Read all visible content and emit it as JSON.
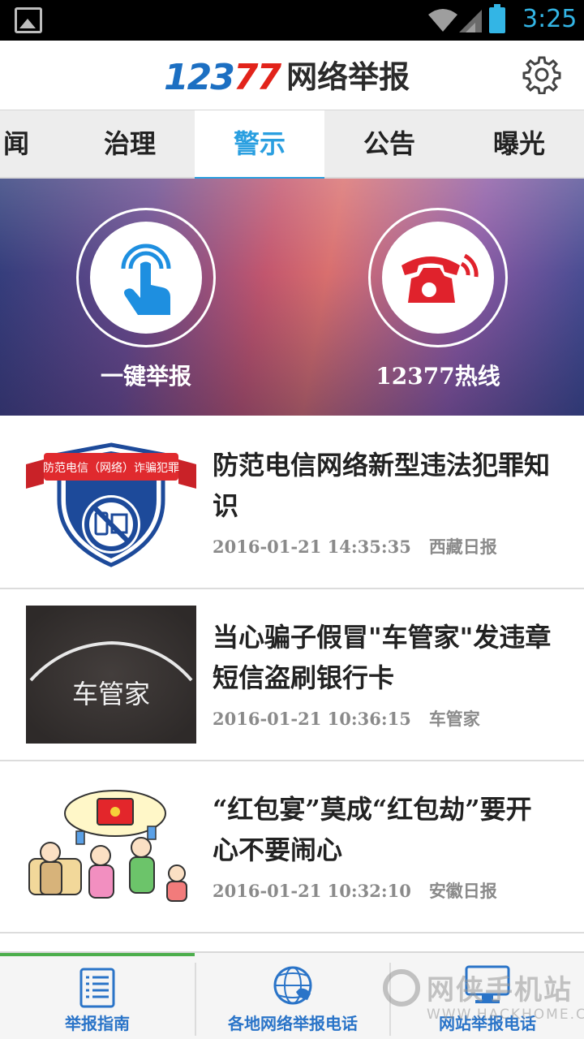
{
  "status_bar": {
    "time": "3:25"
  },
  "header": {
    "logo_number": "12377",
    "logo_number_a": "123",
    "logo_number_b": "77",
    "title": "网络举报"
  },
  "tabs": [
    {
      "label": "闻",
      "active": false
    },
    {
      "label": "治理",
      "active": false
    },
    {
      "label": "警示",
      "active": true
    },
    {
      "label": "公告",
      "active": false
    },
    {
      "label": "曝光",
      "active": false
    }
  ],
  "banner": {
    "left_label": "一键举报",
    "right_label": "12377热线"
  },
  "news": [
    {
      "title": "防范电信网络新型违法犯罪知识",
      "date": "2016-01-21 14:35:35",
      "source": "西藏日报",
      "thumb_text": "防范电信（网络）诈骗犯罪"
    },
    {
      "title": "当心骗子假冒\"车管家\"发违章短信盗刷银行卡",
      "date": "2016-01-21 10:36:15",
      "source": "车管家",
      "thumb_text": "车管家"
    },
    {
      "title": "“红包宴”莫成“红包劫”要开心不要闹心",
      "date": "2016-01-21 10:32:10",
      "source": "安徽日报"
    }
  ],
  "bottom_nav": [
    {
      "label": "举报指南",
      "icon": "document-list-icon"
    },
    {
      "label": "各地网络举报电话",
      "icon": "globe-phone-icon"
    },
    {
      "label": "网站举报电话",
      "icon": "monitor-icon"
    }
  ],
  "watermark": {
    "main": "网侠手机站",
    "sub": "WWW.HACKHOME.COM"
  },
  "colors": {
    "accent": "#2a9fe0",
    "logo_blue": "#1c6fc2",
    "logo_red": "#e2231a",
    "nav_label": "#2a74c8"
  }
}
